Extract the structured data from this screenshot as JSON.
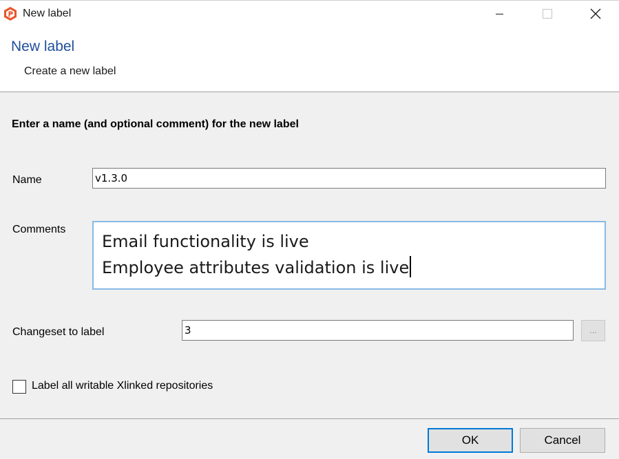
{
  "window": {
    "title": "New label",
    "icon": "plastic-scm-logo-icon",
    "controls": [
      "minimize-icon",
      "maximize-icon",
      "close-icon"
    ]
  },
  "header": {
    "title": "New label",
    "subtitle": "Create a new label"
  },
  "form": {
    "instruction": "Enter a name (and optional comment) for the new label",
    "name_label": "Name",
    "name_value": "v1.3.0",
    "comments_label": "Comments",
    "comments_lines": [
      "Email functionality is live",
      "Employee attributes validation is live"
    ],
    "changeset_label": "Changeset to label",
    "changeset_value": "3",
    "browse_label": "...",
    "xlinked_checkbox_label": "Label all writable Xlinked repositories",
    "xlinked_checked": false
  },
  "buttons": {
    "ok": "OK",
    "cancel": "Cancel"
  },
  "colors": {
    "header_title": "#1f4e9c",
    "brand_orange": "#e8562a",
    "focus_border": "#86bae6",
    "default_button_border": "#0078d7"
  }
}
